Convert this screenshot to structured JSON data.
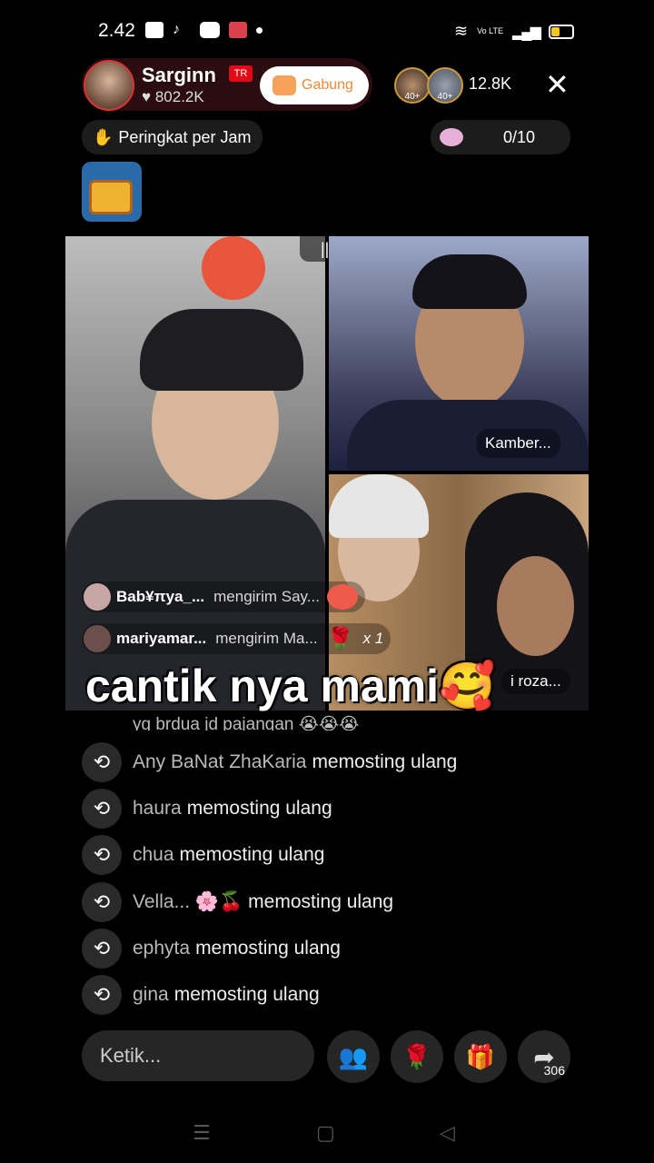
{
  "status": {
    "time": "2.42",
    "signal": "Vo LTE"
  },
  "host": {
    "name": "Sarginn",
    "flag": "TR",
    "likes": "802.2K",
    "join_label": "Gabung"
  },
  "viewers": {
    "badge1": "40+",
    "badge2": "40+",
    "count": "12.8K"
  },
  "rank": {
    "label": "Peringkat per Jam"
  },
  "goal": {
    "value": "0/10"
  },
  "video": {
    "top_right_name": "Kamber...",
    "bottom_right_name": "i roza...",
    "gift_rows": [
      {
        "user": "Bab¥πya_...",
        "action": "mengirim Say...",
        "count": ""
      },
      {
        "user": "mariyamar...",
        "action": "mengirim Ma...",
        "count": "x 1"
      }
    ],
    "caption": "cantik nya mami🥰"
  },
  "comments": {
    "partial": "yg brdua jd pajangan 😭😭😭",
    "items": [
      {
        "user": "Any BaNat ZhaKaria",
        "action": "memosting ulang"
      },
      {
        "user": "haura",
        "action": "memosting ulang"
      },
      {
        "user": "chua",
        "action": "memosting ulang"
      },
      {
        "user": "Vella... 🌸🍒",
        "action": "memosting ulang"
      },
      {
        "user": "ephyta",
        "action": "memosting ulang"
      },
      {
        "user": "gina",
        "action": "memosting ulang"
      }
    ]
  },
  "bottom": {
    "input_placeholder": "Ketik...",
    "share_count": "306"
  },
  "colors": {
    "join_text": "#f08a38",
    "accent_red": "#e02b3a"
  }
}
